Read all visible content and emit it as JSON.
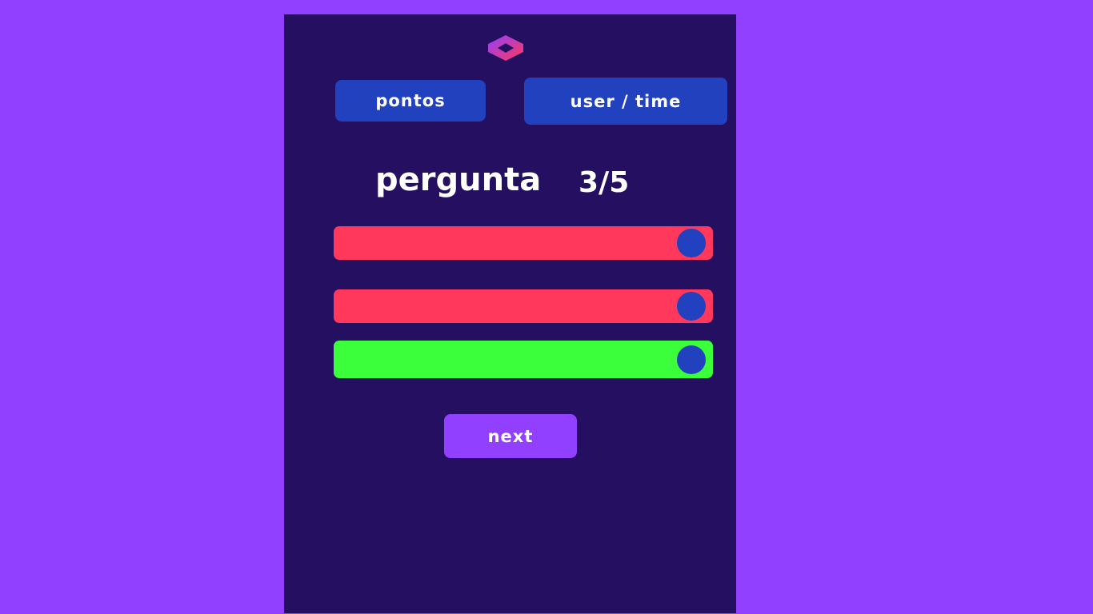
{
  "colors": {
    "page_background": "#9140ff",
    "panel_background": "#250f61",
    "button_blue": "#2141bf",
    "answer_wrong": "#ff385c",
    "answer_correct": "#3bff3b",
    "knob": "#2141bf",
    "next_button": "#9140ff",
    "text": "#ffffff"
  },
  "header": {
    "logo_icon": "cube-logo-icon",
    "score_label": "pontos",
    "user_label": "user / time"
  },
  "question": {
    "label": "pergunta",
    "progress": "3/5"
  },
  "answers": [
    {
      "text": "",
      "state": "wrong",
      "color": "#ff385c"
    },
    {
      "text": "",
      "state": "wrong",
      "color": "#ff385c"
    },
    {
      "text": "",
      "state": "correct",
      "color": "#3bff3b"
    }
  ],
  "footer": {
    "next_label": "next"
  }
}
